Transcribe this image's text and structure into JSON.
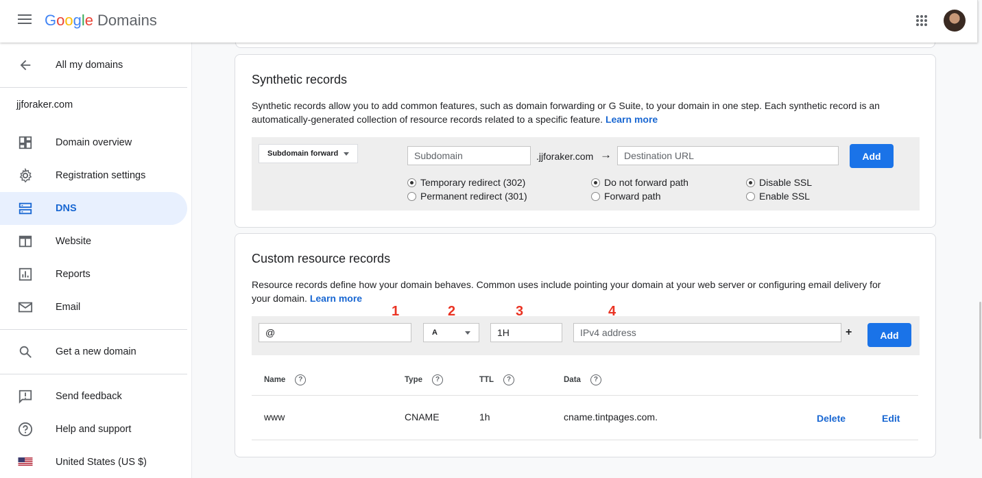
{
  "header": {
    "logo_letters": [
      "G",
      "o",
      "o",
      "g",
      "l",
      "e"
    ],
    "product": "Domains"
  },
  "sidebar": {
    "back_label": "All my domains",
    "domain": "jjforaker.com",
    "items": [
      {
        "label": "Domain overview",
        "icon": "dashboard-icon"
      },
      {
        "label": "Registration settings",
        "icon": "gear-icon"
      },
      {
        "label": "DNS",
        "icon": "dns-icon"
      },
      {
        "label": "Website",
        "icon": "website-icon"
      },
      {
        "label": "Reports",
        "icon": "reports-icon"
      },
      {
        "label": "Email",
        "icon": "email-icon"
      }
    ],
    "get_domain": "Get a new domain",
    "feedback": "Send feedback",
    "help": "Help and support",
    "region": "United States (US $)"
  },
  "synthetic": {
    "title": "Synthetic records",
    "desc_line1": "Synthetic records allow you to add common features, such as domain forwarding or G Suite, to your domain in one step. Each synthetic record is an",
    "desc_line2": "automatically-generated collection of resource records related to a specific feature.",
    "learn_more": "Learn more",
    "type_select": "Subdomain forward",
    "subdomain_placeholder": "Subdomain",
    "domain_suffix": ".jjforaker.com",
    "arrow": "→",
    "dest_placeholder": "Destination URL",
    "add_label": "Add",
    "radios": {
      "temp": "Temporary redirect (302)",
      "perm": "Permanent redirect (301)",
      "no_path": "Do not forward path",
      "path": "Forward path",
      "disable_ssl": "Disable SSL",
      "enable_ssl": "Enable SSL"
    }
  },
  "custom": {
    "title": "Custom resource records",
    "desc_line1": "Resource records define how your domain behaves. Common uses include pointing your domain at your web server or configuring email delivery for",
    "desc_line2": "your domain.",
    "learn_more": "Learn more",
    "annotations": [
      "1",
      "2",
      "3",
      "4"
    ],
    "name_value": "@",
    "type_value": "A",
    "ttl_value": "1H",
    "data_placeholder": "IPv4 address",
    "plus": "+",
    "add_label": "Add",
    "columns": [
      "Name",
      "Type",
      "TTL",
      "Data"
    ],
    "help_glyph": "?",
    "rows": [
      {
        "name": "www",
        "type": "CNAME",
        "ttl": "1h",
        "data": "cname.tintpages.com.",
        "delete": "Delete",
        "edit": "Edit"
      }
    ]
  },
  "colors": {
    "accent": "#1a73e8",
    "annotation": "#ea3323",
    "active_bg": "#e8f0fe"
  }
}
